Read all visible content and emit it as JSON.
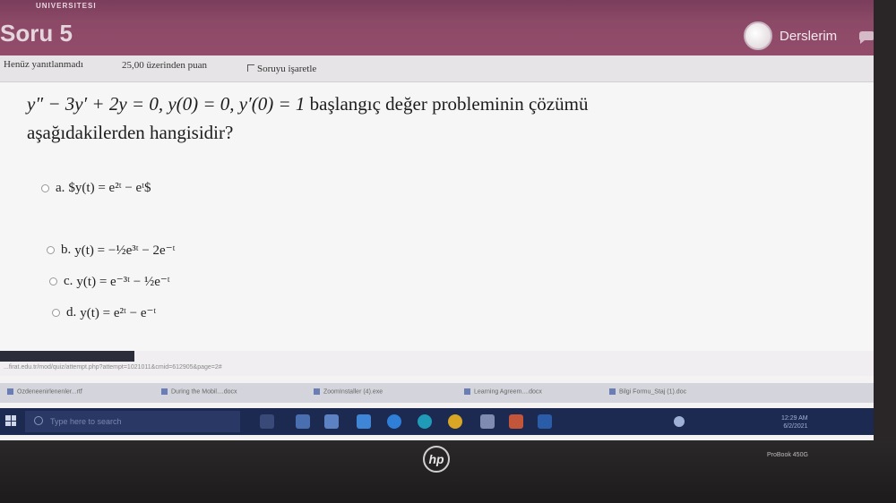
{
  "header": {
    "university": "UNIVERSITESI",
    "title": "Soru 5",
    "nav_label": "Derslerim"
  },
  "info": {
    "status": "Henüz yanıtlanmadı",
    "points": "25,00 üzerinden puan",
    "flag_label": "Soruyu işaretle"
  },
  "question": {
    "equation": "y″ − 3y′ + 2y = 0,  y(0) = 0,  y′(0) = 1",
    "tail": " başlangıç değer probleminin çözümü",
    "line2": "aşağıdakilerden hangisidir?"
  },
  "options": [
    {
      "letter": "a.",
      "text": "$y(t) = e²ᵗ − eᵗ$"
    },
    {
      "letter": "b.",
      "text": "y(t) = −½e³ᵗ − 2e⁻ᵗ"
    },
    {
      "letter": "c.",
      "text": "y(t) = e⁻³ᵗ − ½e⁻ᵗ"
    },
    {
      "letter": "d.",
      "text": "y(t) = e²ᵗ − e⁻ᵗ"
    }
  ],
  "status_url": "...firat.edu.tr/mod/quiz/attempt.php?attempt=1021011&cmid=612905&page=2#",
  "downloads": [
    "Ozdeneenirlenenler...rtf",
    "During the Mobil....docx",
    "ZoomInstaller (4).exe",
    "Learning Agreem....docx",
    "Bilgi Formu_Staj (1).doc"
  ],
  "taskbar": {
    "search_placeholder": "Type here to search",
    "time": "12:29 AM",
    "date": "6/2/2021"
  },
  "device": {
    "brand": "hp",
    "model": "ProBook 450G"
  },
  "colors": {
    "header": "#8c4a67",
    "taskbar": "#1c2a52"
  }
}
